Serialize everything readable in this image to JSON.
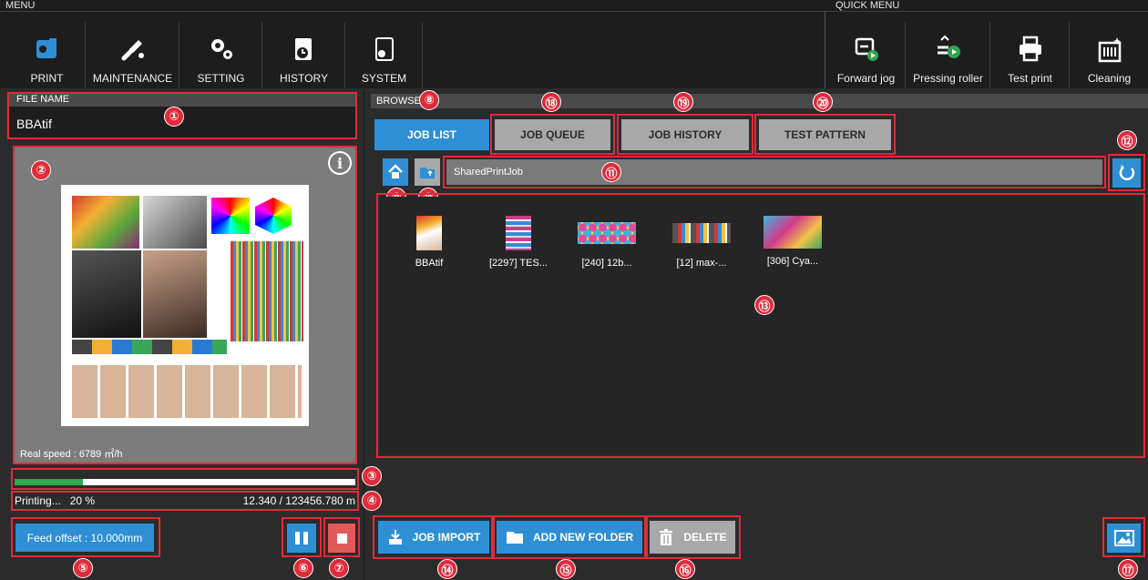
{
  "menu": {
    "caption": "MENU",
    "items": [
      {
        "label": "PRINT",
        "icon": "print-icon"
      },
      {
        "label": "MAINTENANCE",
        "icon": "maintenance-icon"
      },
      {
        "label": "SETTING",
        "icon": "setting-icon"
      },
      {
        "label": "HISTORY",
        "icon": "history-icon"
      },
      {
        "label": "SYSTEM",
        "icon": "system-icon"
      }
    ]
  },
  "quick_menu": {
    "caption": "QUICK MENU",
    "items": [
      {
        "label": "Forward jog",
        "icon": "forward-jog-icon"
      },
      {
        "label": "Pressing roller",
        "icon": "pressing-roller-icon"
      },
      {
        "label": "Test print",
        "icon": "test-print-icon"
      },
      {
        "label": "Cleaning",
        "icon": "cleaning-icon"
      }
    ]
  },
  "file_name": {
    "caption": "FILE NAME",
    "value": "BBAtif"
  },
  "preview": {
    "speed_text": "Real speed : 6789 ㎡/h",
    "info_icon": "info-icon"
  },
  "progress": {
    "fraction": 0.2,
    "status": "Printing...",
    "percent": "20 %",
    "length": "12.340 / 123456.780 m"
  },
  "feed_offset": "Feed offset : 10.000mm",
  "browse": {
    "caption": "BROWSE",
    "tabs": [
      {
        "label": "JOB LIST",
        "active": true
      },
      {
        "label": "JOB QUEUE",
        "active": false
      },
      {
        "label": "JOB HISTORY",
        "active": false
      },
      {
        "label": "TEST PATTERN",
        "active": false
      }
    ],
    "path": "SharedPrintJob",
    "files": [
      {
        "name": "BBAtif"
      },
      {
        "name": "[2297] TES..."
      },
      {
        "name": "[240] 12b..."
      },
      {
        "name": "[12] max-..."
      },
      {
        "name": "[306] Cya..."
      }
    ]
  },
  "actions": {
    "import": "JOB IMPORT",
    "new_folder": "ADD NEW FOLDER",
    "delete": "DELETE"
  },
  "markers": [
    "①",
    "②",
    "③",
    "④",
    "⑤",
    "⑥",
    "⑦",
    "⑧",
    "⑨",
    "⑩",
    "⑪",
    "⑫",
    "⑬",
    "⑭",
    "⑮",
    "⑯",
    "⑰",
    "⑱",
    "⑲",
    "⑳"
  ],
  "colors": {
    "accent": "#2e8fd5",
    "annotation": "#e02b3a",
    "stop": "#e05a5a",
    "progress": "#2fa84f"
  }
}
